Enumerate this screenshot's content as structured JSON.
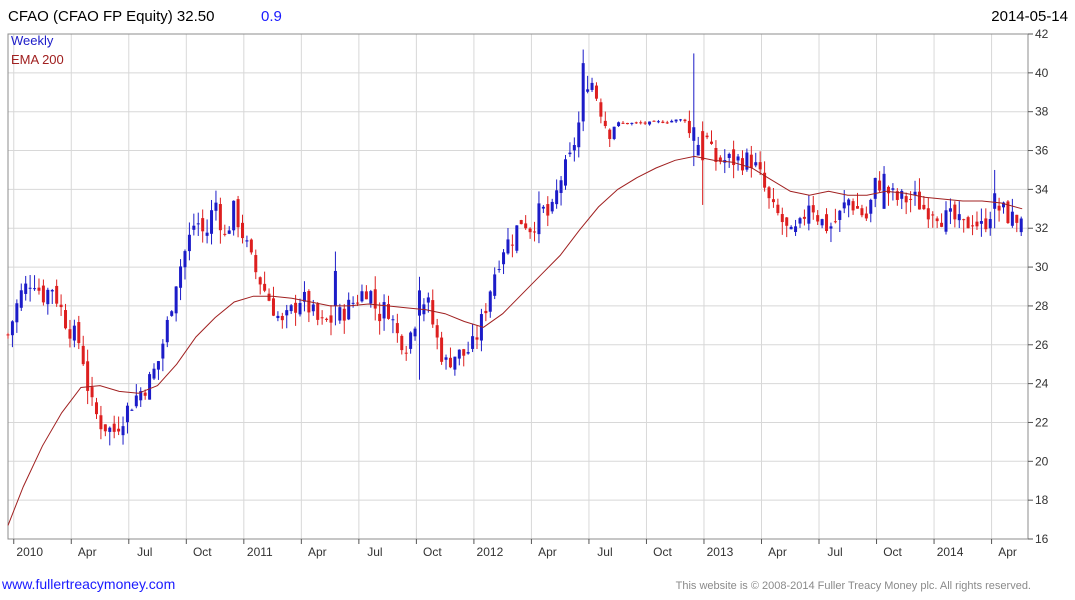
{
  "header": {
    "title": "CFAO (CFAO FP Equity) 32.50",
    "change": "0.9",
    "date": "2014-05-14"
  },
  "legend": {
    "weekly": "Weekly",
    "ema": "EMA 200"
  },
  "footer": {
    "url": "www.fullertreacymoney.com",
    "copyright": "This website is © 2008-2014 Fuller Treacy Money plc. All rights reserved."
  },
  "colors": {
    "up": "#1c1cc8",
    "down": "#dd1f1f",
    "ema": "#a02020",
    "grid": "#d8d8d8",
    "title_change": "#1a1aff"
  },
  "chart_data": {
    "type": "candlestick",
    "title": "CFAO (CFAO FP Equity) 32.50 0.9",
    "date": "2014-05-14",
    "y_axis_position": "right",
    "ylim": [
      16,
      42
    ],
    "yticks": [
      16,
      18,
      20,
      22,
      24,
      26,
      28,
      30,
      32,
      34,
      36,
      38,
      40,
      42
    ],
    "grid": true,
    "legend_placement": "top-left",
    "x_ticks": [
      {
        "label": "2010",
        "t": 0
      },
      {
        "label": "Apr",
        "t": 3
      },
      {
        "label": "Jul",
        "t": 6
      },
      {
        "label": "Oct",
        "t": 9
      },
      {
        "label": "2011",
        "t": 12
      },
      {
        "label": "Apr",
        "t": 15
      },
      {
        "label": "Jul",
        "t": 18
      },
      {
        "label": "Oct",
        "t": 21
      },
      {
        "label": "2012",
        "t": 24
      },
      {
        "label": "Apr",
        "t": 27
      },
      {
        "label": "Jul",
        "t": 30
      },
      {
        "label": "Oct",
        "t": 33
      },
      {
        "label": "2013",
        "t": 36
      },
      {
        "label": "Apr",
        "t": 39
      },
      {
        "label": "Jul",
        "t": 42
      },
      {
        "label": "Oct",
        "t": 45
      },
      {
        "label": "2014",
        "t": 48
      },
      {
        "label": "Apr",
        "t": 51
      }
    ],
    "close_path": [
      [
        -0.3,
        26.5
      ],
      [
        0.3,
        28.5
      ],
      [
        1.0,
        29.5
      ],
      [
        1.5,
        28.5
      ],
      [
        2.0,
        29.0
      ],
      [
        2.8,
        27.0
      ],
      [
        3.5,
        26.0
      ],
      [
        4.0,
        23.0
      ],
      [
        4.5,
        22.0
      ],
      [
        5.2,
        21.5
      ],
      [
        5.8,
        22.5
      ],
      [
        6.5,
        23.5
      ],
      [
        7.0,
        24.0
      ],
      [
        7.5,
        25.0
      ],
      [
        8.0,
        27.0
      ],
      [
        8.5,
        29.5
      ],
      [
        9.0,
        31.0
      ],
      [
        9.5,
        32.5
      ],
      [
        10.0,
        31.5
      ],
      [
        10.5,
        33.5
      ],
      [
        11.0,
        31.5
      ],
      [
        11.5,
        33.0
      ],
      [
        12.0,
        31.5
      ],
      [
        12.5,
        30.0
      ],
      [
        13.0,
        29.0
      ],
      [
        14.0,
        27.0
      ],
      [
        15.0,
        28.5
      ],
      [
        16.0,
        27.0
      ],
      [
        17.0,
        27.5
      ],
      [
        18.0,
        28.5
      ],
      [
        18.5,
        29.0
      ],
      [
        19.0,
        27.5
      ],
      [
        19.5,
        28.0
      ],
      [
        20.0,
        26.5
      ],
      [
        20.5,
        26.0
      ],
      [
        21.0,
        27.5
      ],
      [
        21.5,
        28.5
      ],
      [
        22.0,
        26.5
      ],
      [
        22.5,
        25.0
      ],
      [
        23.0,
        25.5
      ],
      [
        23.5,
        25.5
      ],
      [
        24.0,
        26.0
      ],
      [
        24.5,
        27.5
      ],
      [
        25.0,
        29.5
      ],
      [
        25.5,
        31.0
      ],
      [
        26.0,
        31.5
      ],
      [
        26.5,
        32.5
      ],
      [
        27.0,
        32.0
      ],
      [
        27.5,
        33.0
      ],
      [
        28.0,
        32.5
      ],
      [
        28.5,
        34.5
      ],
      [
        29.0,
        35.5
      ],
      [
        29.5,
        37.5
      ],
      [
        30.0,
        40.0
      ],
      [
        30.5,
        38.5
      ],
      [
        31.0,
        37.0
      ],
      [
        31.5,
        37.4
      ],
      [
        32.0,
        37.4
      ],
      [
        33.0,
        37.4
      ],
      [
        34.0,
        37.5
      ],
      [
        35.0,
        37.6
      ],
      [
        35.5,
        36.0
      ],
      [
        36.0,
        37.0
      ],
      [
        36.5,
        35.5
      ],
      [
        37.0,
        35.5
      ],
      [
        38.0,
        35.5
      ],
      [
        38.5,
        35.5
      ],
      [
        39.0,
        34.5
      ],
      [
        39.5,
        33.0
      ],
      [
        40.0,
        32.5
      ],
      [
        40.5,
        31.5
      ],
      [
        41.0,
        32.0
      ],
      [
        41.5,
        33.5
      ],
      [
        42.0,
        32.5
      ],
      [
        42.5,
        32.0
      ],
      [
        43.0,
        32.5
      ],
      [
        43.5,
        33.5
      ],
      [
        44.0,
        33.0
      ],
      [
        44.5,
        32.5
      ],
      [
        45.0,
        34.5
      ],
      [
        45.5,
        34.0
      ],
      [
        46.0,
        33.5
      ],
      [
        46.5,
        33.5
      ],
      [
        47.0,
        33.5
      ],
      [
        47.5,
        33.0
      ],
      [
        48.0,
        33.0
      ],
      [
        48.5,
        32.5
      ],
      [
        49.0,
        32.5
      ],
      [
        49.5,
        32.0
      ],
      [
        50.0,
        32.5
      ],
      [
        50.5,
        32.0
      ],
      [
        51.0,
        33.0
      ],
      [
        51.5,
        33.0
      ],
      [
        52.0,
        32.5
      ],
      [
        52.6,
        32.5
      ]
    ],
    "ema_200": [
      [
        -0.3,
        16.7
      ],
      [
        0.5,
        18.7
      ],
      [
        1.5,
        20.8
      ],
      [
        2.5,
        22.5
      ],
      [
        3.5,
        23.8
      ],
      [
        4.5,
        23.9
      ],
      [
        5.5,
        23.6
      ],
      [
        6.5,
        23.5
      ],
      [
        7.5,
        23.9
      ],
      [
        8.5,
        25.0
      ],
      [
        9.5,
        26.4
      ],
      [
        10.5,
        27.4
      ],
      [
        11.5,
        28.2
      ],
      [
        12.5,
        28.5
      ],
      [
        13.5,
        28.5
      ],
      [
        14.5,
        28.4
      ],
      [
        15.5,
        28.2
      ],
      [
        16.5,
        28.0
      ],
      [
        17.5,
        28.0
      ],
      [
        18.5,
        28.1
      ],
      [
        19.5,
        28.0
      ],
      [
        20.5,
        27.9
      ],
      [
        21.5,
        27.8
      ],
      [
        22.5,
        27.6
      ],
      [
        23.5,
        27.2
      ],
      [
        24.5,
        26.9
      ],
      [
        25.5,
        27.6
      ],
      [
        26.5,
        28.6
      ],
      [
        27.5,
        29.6
      ],
      [
        28.5,
        30.6
      ],
      [
        29.5,
        31.9
      ],
      [
        30.5,
        33.1
      ],
      [
        31.5,
        34.0
      ],
      [
        32.5,
        34.6
      ],
      [
        33.5,
        35.1
      ],
      [
        34.5,
        35.5
      ],
      [
        35.5,
        35.7
      ],
      [
        36.5,
        35.5
      ],
      [
        37.5,
        35.4
      ],
      [
        38.5,
        35.1
      ],
      [
        39.5,
        34.5
      ],
      [
        40.5,
        33.9
      ],
      [
        41.5,
        33.7
      ],
      [
        42.5,
        33.9
      ],
      [
        43.5,
        33.7
      ],
      [
        44.5,
        33.7
      ],
      [
        45.5,
        33.9
      ],
      [
        46.5,
        33.8
      ],
      [
        47.5,
        33.6
      ],
      [
        48.5,
        33.5
      ],
      [
        49.5,
        33.4
      ],
      [
        50.5,
        33.4
      ],
      [
        51.5,
        33.3
      ],
      [
        52.6,
        33.0
      ]
    ],
    "notable_bars": [
      {
        "t": 29.8,
        "open": 37.5,
        "high": 41.2,
        "low": 37.0,
        "close": 40.5
      },
      {
        "t": 35.5,
        "open": 36.5,
        "high": 41.0,
        "low": 35.2,
        "close": 37.2
      },
      {
        "t": 36.0,
        "open": 37.0,
        "high": 37.5,
        "low": 33.2,
        "close": 35.5
      },
      {
        "t": 16.8,
        "open": 28.0,
        "high": 30.8,
        "low": 27.0,
        "close": 29.8
      },
      {
        "t": 21.1,
        "open": 27.5,
        "high": 29.5,
        "low": 24.2,
        "close": 28.8
      },
      {
        "t": 45.5,
        "open": 33.0,
        "high": 35.2,
        "low": 33.0,
        "close": 34.8
      },
      {
        "t": 51.2,
        "open": 33.0,
        "high": 35.0,
        "low": 32.0,
        "close": 33.8
      },
      {
        "t": 52.6,
        "open": 31.8,
        "high": 32.6,
        "low": 31.6,
        "close": 32.5
      }
    ]
  }
}
